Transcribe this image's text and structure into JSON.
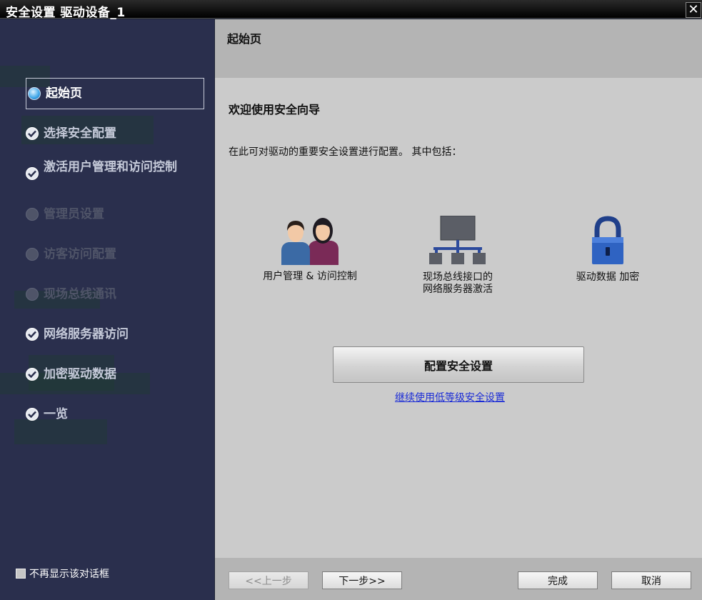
{
  "window": {
    "title": "安全设置 驱动设备_1",
    "close_glyph": "✕"
  },
  "sidebar": {
    "items": [
      {
        "label": "起始页",
        "state": "current"
      },
      {
        "label": "选择安全配置",
        "state": "done"
      },
      {
        "label": "激活用户管理和访问控制",
        "state": "done"
      },
      {
        "label": "管理员设置",
        "state": "disabled"
      },
      {
        "label": "访客访问配置",
        "state": "disabled"
      },
      {
        "label": "现场总线通讯",
        "state": "disabled"
      },
      {
        "label": "网络服务器访问",
        "state": "done"
      },
      {
        "label": "加密驱动数据",
        "state": "done"
      },
      {
        "label": "一览",
        "state": "done"
      }
    ],
    "dont_show_label": "不再显示该对话框",
    "dont_show_checked": false
  },
  "header": {
    "heading": "起始页"
  },
  "main": {
    "welcome": "欢迎使用安全向导",
    "intro": "在此可对驱动的重要安全设置进行配置。 其中包括：",
    "features": [
      {
        "icon": "users-icon",
        "line1": "用户管理 & 访问控制",
        "line2": ""
      },
      {
        "icon": "network-icon",
        "line1": "现场总线接口的",
        "line2": "网络服务器激活"
      },
      {
        "icon": "lock-icon",
        "line1": "驱动数据 加密",
        "line2": ""
      }
    ],
    "configure_button": "配置安全设置",
    "low_security_link": "继续使用低等级安全设置"
  },
  "footer": {
    "back": "<<上一步",
    "next": "下一步>>",
    "finish": "完成",
    "cancel": "取消"
  },
  "colors": {
    "sidebar_bg": "#2a2f4d",
    "header_bg": "#b4b4b4",
    "content_bg": "#cbcbcb",
    "link": "#1a2bd6"
  }
}
